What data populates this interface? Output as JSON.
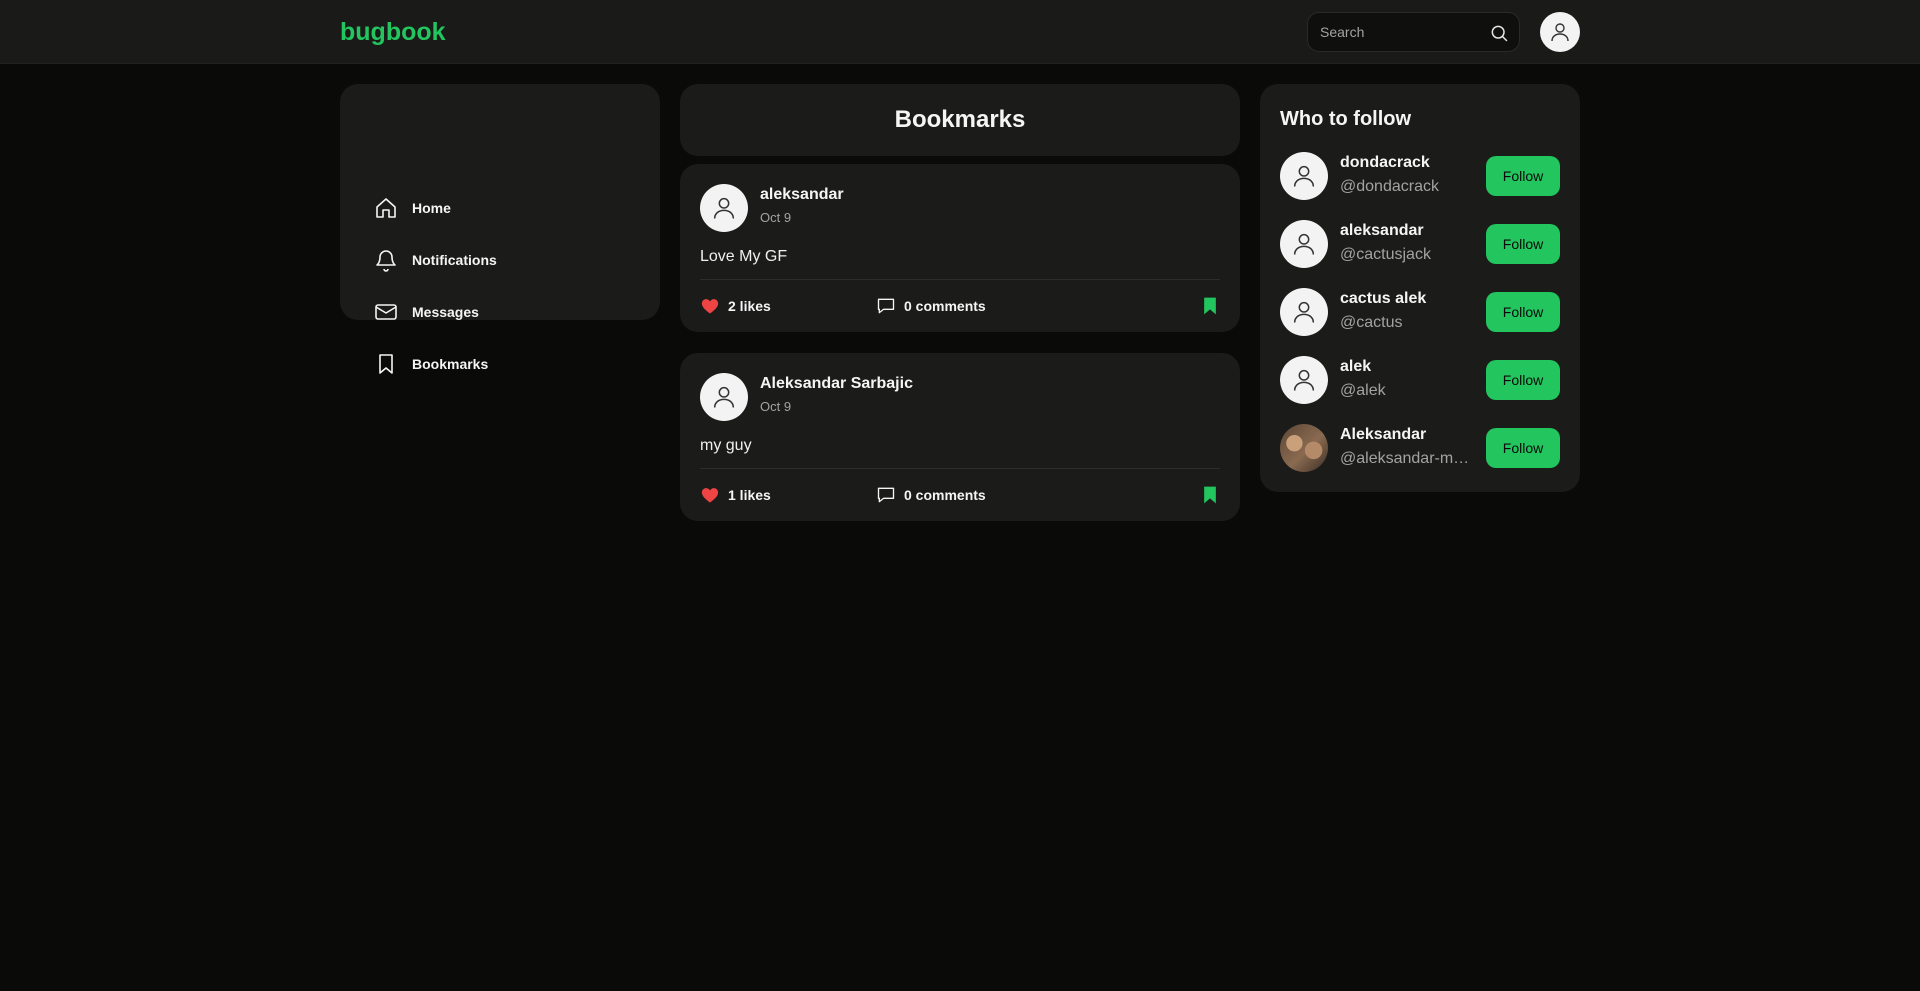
{
  "header": {
    "logo": "bugbook",
    "search_placeholder": "Search",
    "search_icon": "search-icon",
    "user_icon": "user-icon"
  },
  "menu": {
    "items": [
      {
        "label": "Home",
        "icon": "home-icon"
      },
      {
        "label": "Notifications",
        "icon": "bell-icon"
      },
      {
        "label": "Messages",
        "icon": "mail-icon"
      },
      {
        "label": "Bookmarks",
        "icon": "bookmark-icon"
      }
    ]
  },
  "page": {
    "title": "Bookmarks"
  },
  "posts": [
    {
      "author": "aleksandar",
      "date": "Oct 9",
      "content": "Love My GF",
      "likes": "2 likes",
      "comments": "0 comments",
      "bookmarked": true
    },
    {
      "author": "Aleksandar Sarbajic",
      "date": "Oct 9",
      "content": "my guy",
      "likes": "1 likes",
      "comments": "0 comments",
      "bookmarked": true
    }
  ],
  "who_to_follow": {
    "title": "Who to follow",
    "button_label": "Follow",
    "users": [
      {
        "name": "dondacrack",
        "handle": "@dondacrack"
      },
      {
        "name": "aleksandar",
        "handle": "@cactusjack"
      },
      {
        "name": "cactus alek",
        "handle": "@cactus"
      },
      {
        "name": "alek",
        "handle": "@alek"
      },
      {
        "name": "Aleksandar",
        "handle": "@aleksandar-mx..."
      }
    ]
  },
  "colors": {
    "accent": "#22c55e",
    "like": "#ef4444",
    "background": "#0a0a09",
    "card": "#1b1b1a"
  }
}
